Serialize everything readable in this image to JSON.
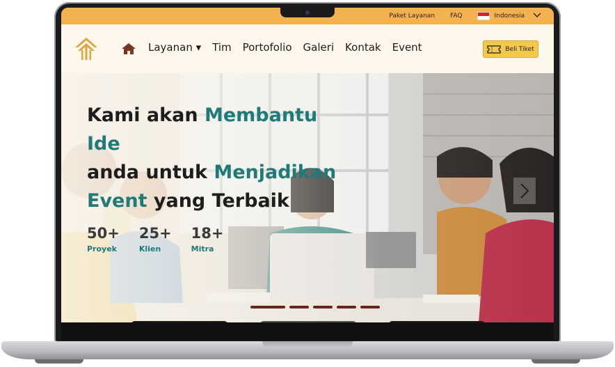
{
  "topbar": {
    "links": [
      "Paket Layanan",
      "FAQ"
    ],
    "language": "Indonesia",
    "color": "#f3b24f"
  },
  "nav": {
    "items": [
      "Layanan ▾",
      "Tim",
      "Portofolio",
      "Galeri",
      "Kontak",
      "Event"
    ],
    "ticket_button": "Beli Tiket",
    "background": "#fdf7ec"
  },
  "hero": {
    "line1_plain": "Kami akan ",
    "line1_accent": "Membantu Ide",
    "line2_plain": "anda untuk ",
    "line2_accent": "Menjadikan",
    "line3_accent": "Event",
    "line3_plain": " yang Terbaik",
    "accent_color": "#1f7a7a",
    "stats": [
      {
        "value": "50+",
        "label": "Proyek"
      },
      {
        "value": "25+",
        "label": "Klien"
      },
      {
        "value": "18+",
        "label": "Mitra"
      }
    ],
    "next_icon": "chevron-right-icon"
  },
  "carousel": {
    "slide_count": 5,
    "active_index": 0
  }
}
